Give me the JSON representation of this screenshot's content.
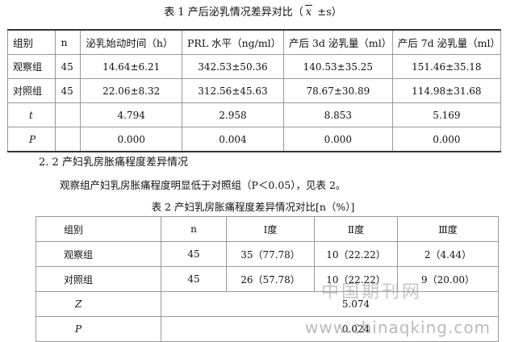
{
  "table1": {
    "caption": "表 1 产后泌乳情况差异对比（",
    "caption_x": "x",
    "caption_tail": " ±s）",
    "headers": [
      "组别",
      "n",
      "泌乳始动时间（h）",
      "PRL 水平（ng/ml）",
      "产后 3d 泌乳量（ml）",
      "产后 7d 泌乳量（ml）"
    ],
    "rows": [
      [
        "观察组",
        "45",
        "14.64±6.21",
        "342.53±50.36",
        "140.53±35.25",
        "151.46±35.18"
      ],
      [
        "对照组",
        "45",
        "22.06±8.32",
        "312.56±45.63",
        "78.67±30.89",
        "114.98±31.68"
      ],
      [
        "t",
        "",
        "4.794",
        "2.958",
        "8.853",
        "5.169"
      ],
      [
        "P",
        "",
        "0.000",
        "0.004",
        "0.000",
        "0.000"
      ]
    ]
  },
  "section_heading": "2. 2 产妇乳房胀痛程度差异情况",
  "paragraph": "观察组产妇乳房胀痛程度明显低于对照组（P＜0.05），见表 2。",
  "table2": {
    "caption": "表 2 产妇乳房胀痛程度差异情况对比[n（%）]",
    "headers": [
      "组别",
      "n",
      "Ⅰ度",
      "Ⅱ度",
      "Ⅲ度"
    ],
    "rows": [
      [
        "观察组",
        "45",
        "35（77.78）",
        "10（22.22）",
        "2（4.44）"
      ],
      [
        "对照组",
        "45",
        "26（57.78）",
        "10（22.22）",
        "9（20.00）"
      ]
    ],
    "z_label": "Z",
    "z_value": "5.074",
    "p_label": "P",
    "p_value": "0.024"
  },
  "watermark": {
    "cn": "中国期刊网",
    "url": "www.chinaqking.com"
  }
}
